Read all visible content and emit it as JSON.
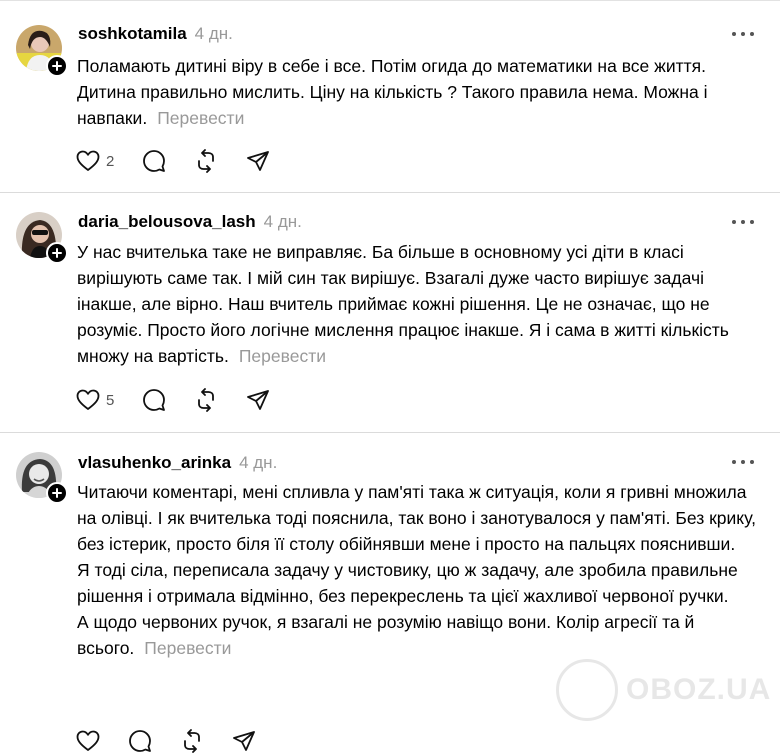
{
  "posts": [
    {
      "username": "soshkotamila",
      "time": "4 дн.",
      "paragraphs": [
        "Поламають дитині віру в себе і все. Потім огида до математики на все життя. Дитина правильно мислить. Ціну на кількість ? Такого правила нема. Можна і навпаки."
      ],
      "translate": "Перевести",
      "likes": "2"
    },
    {
      "username": "daria_belousova_lash",
      "time": "4 дн.",
      "paragraphs": [
        "У нас вчителька таке не виправляє. Ба більше в основному усі діти в класі вирішують саме так. І мій син так вирішує. Взагалі дуже часто вирішує задачі інакше, але вірно. Наш вчитель приймає кожні рішення. Це не означає, що не розуміє. Просто його логічне мислення працює інакше. Я і сама в житті кількість множу на вартість."
      ],
      "translate": "Перевести",
      "likes": "5"
    },
    {
      "username": "vlasuhenko_arinka",
      "time": "4 дн.",
      "paragraphs": [
        "Читаючи коментарі, мені спливла у пам'яті така ж ситуація, коли я гривні множила на олівці. І як вчителька тоді пояснила, так воно і занотувалося у пам'яті. Без крику, без істерик, просто біля її столу обійнявши мене і просто на пальцях пояснивши.",
        "Я тоді сіла, переписала задачу у чистовику, цю ж задачу, але зробила правильне рішення і отримала відмінно, без перекреслень та цієї жахливої червоної ручки.",
        "А щодо червоних ручок, я взагалі не розумію навіщо вони. Колір агресії та й всього."
      ],
      "translate": "Перевести",
      "likes": ""
    }
  ],
  "icons": {
    "like": "heart-icon",
    "comment": "comment-icon",
    "repost": "repost-icon",
    "share": "send-icon",
    "more": "more-icon",
    "follow": "plus-icon"
  },
  "watermark": "OBOZ.UA",
  "colors": {
    "muted": "#999999",
    "separator": "#dbdbdb",
    "text": "#000000"
  }
}
